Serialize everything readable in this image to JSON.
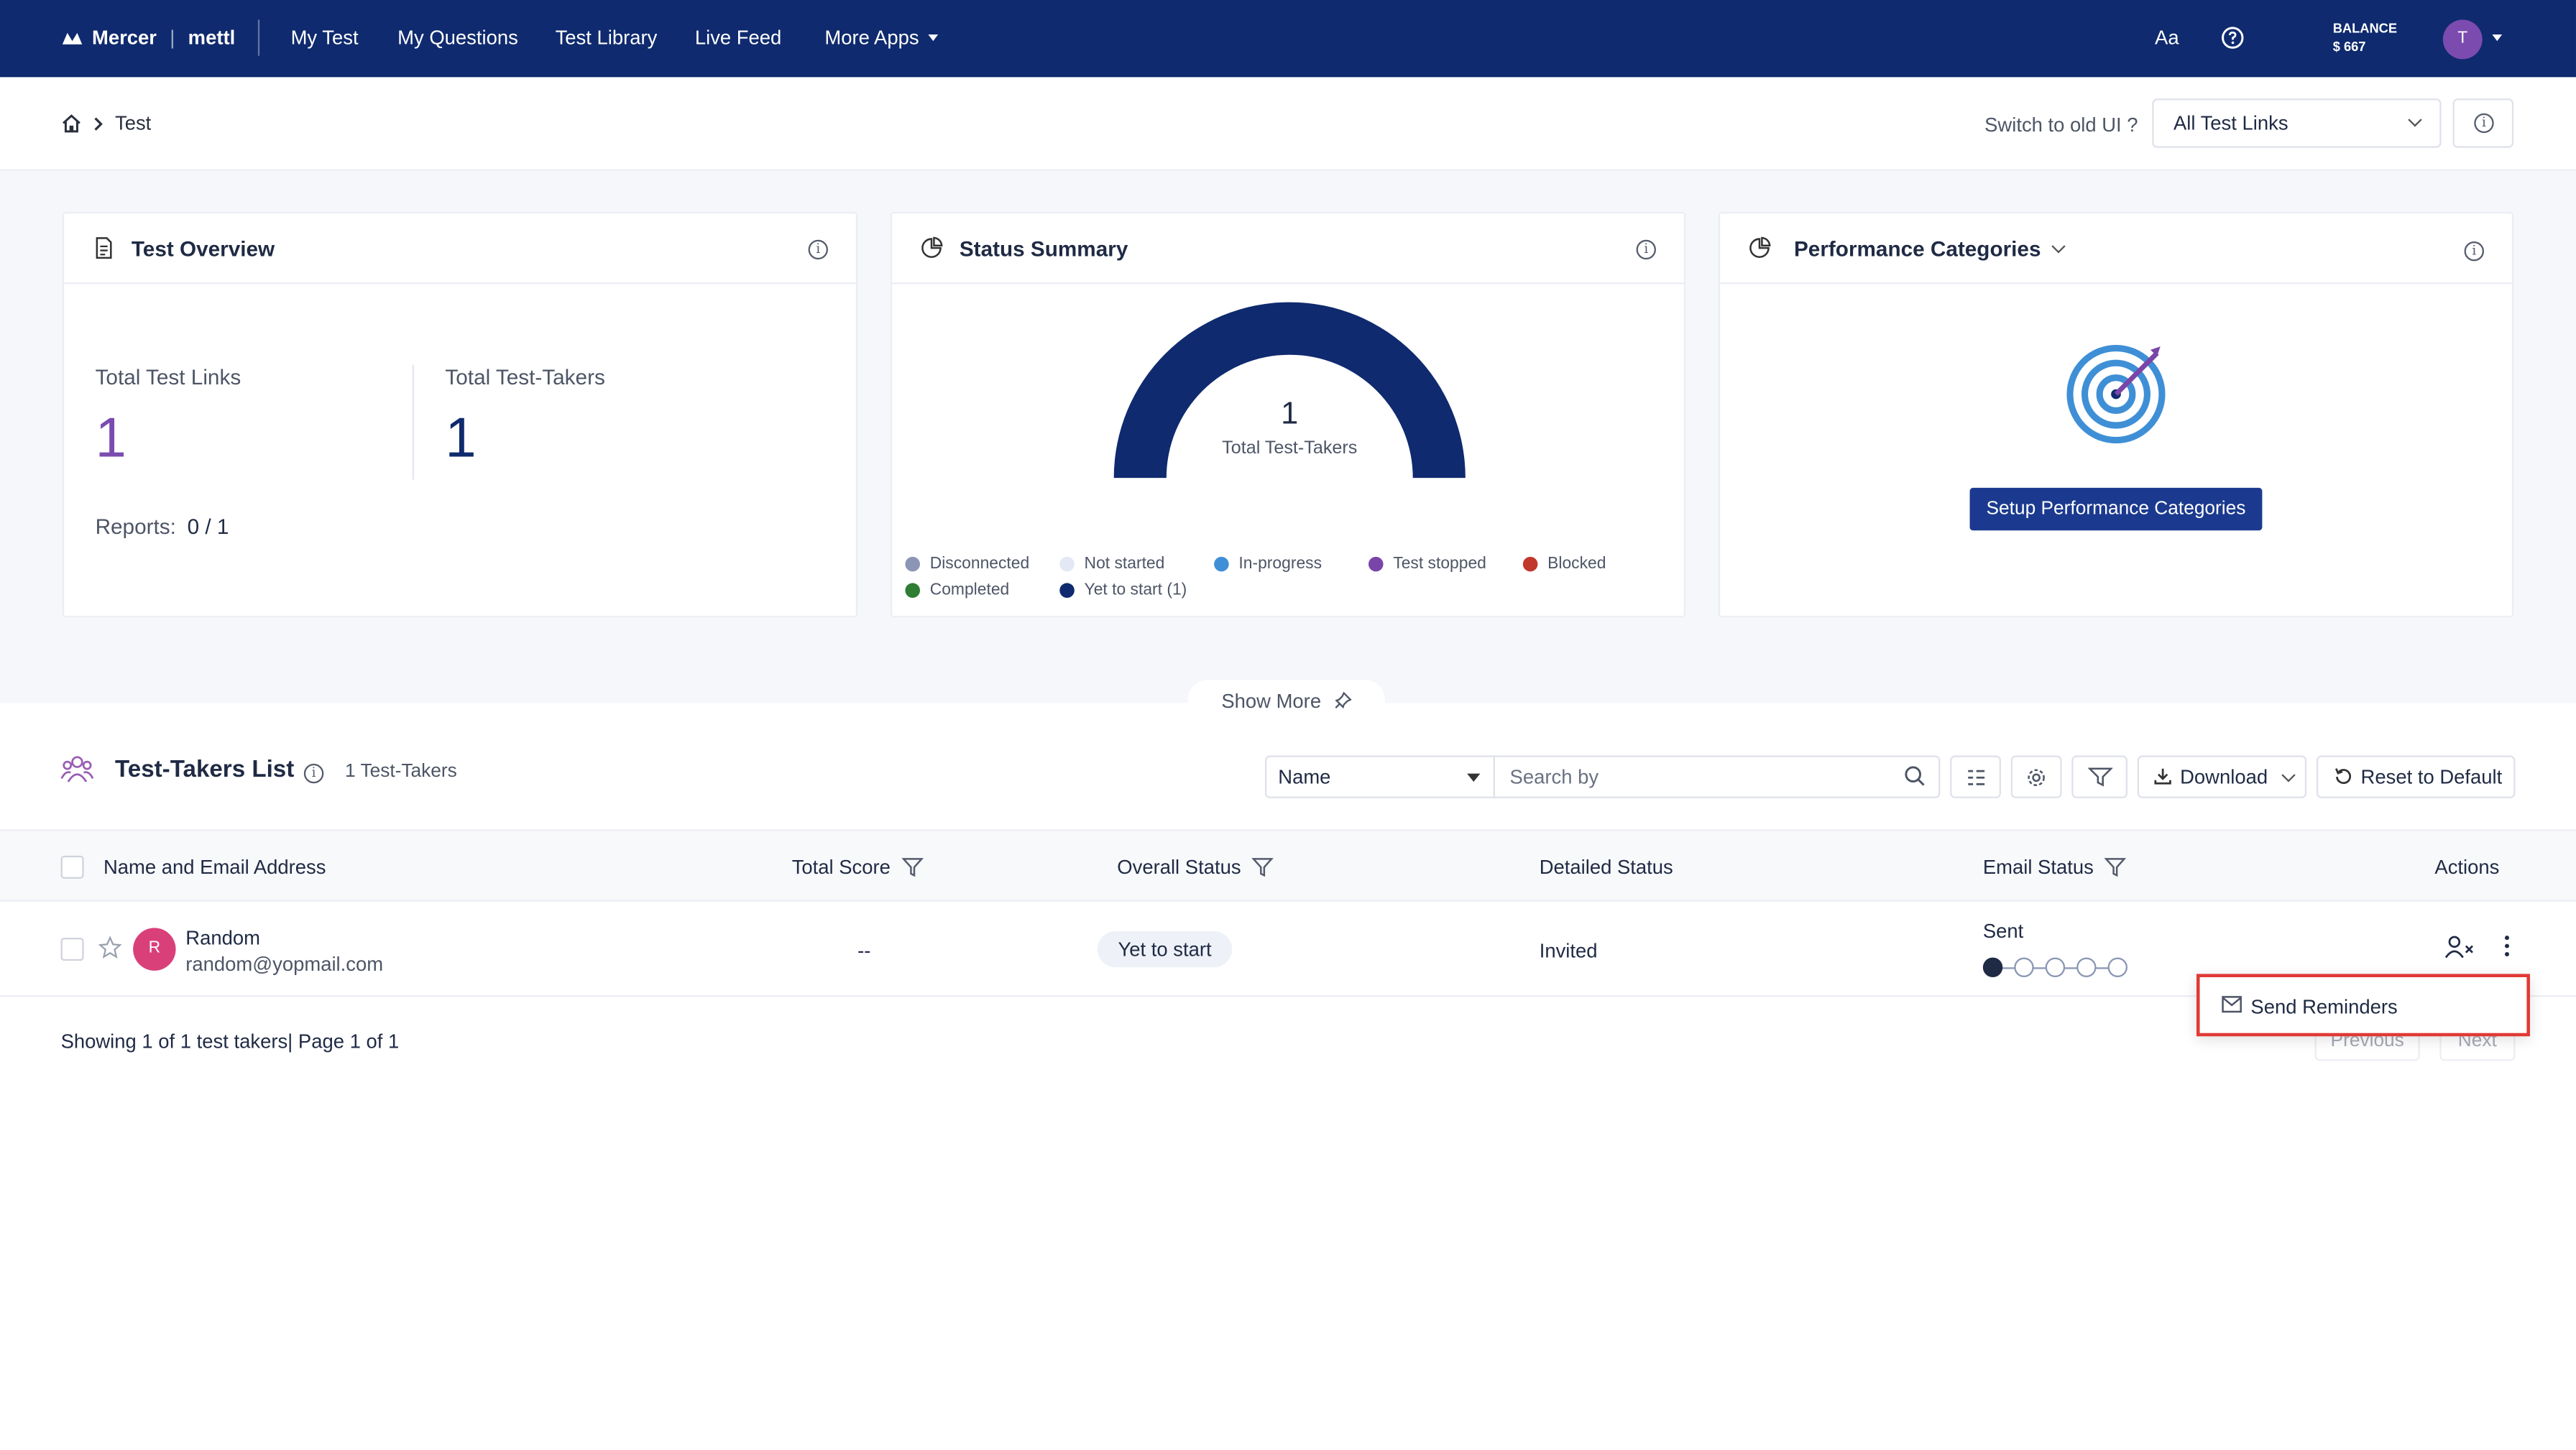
{
  "header": {
    "brand_left": "Mercer",
    "brand_right": "mettl",
    "nav": [
      "My Test",
      "My Questions",
      "Test Library",
      "Live Feed",
      "More Apps"
    ],
    "font_icon": "Aa",
    "balance_label": "BALANCE",
    "balance_value": "$ 667",
    "avatar_initial": "T"
  },
  "subheader": {
    "breadcrumb": "Test",
    "switch_label": "Switch to old UI ?",
    "links_select": "All Test Links"
  },
  "overview": {
    "title": "Test Overview",
    "total_links_label": "Total Test Links",
    "total_links_value": "1",
    "total_takers_label": "Total Test-Takers",
    "total_takers_value": "1",
    "reports_label": "Reports:",
    "reports_value": "0 / 1"
  },
  "status_summary": {
    "title": "Status Summary",
    "center_value": "1",
    "center_label": "Total Test-Takers",
    "legend": [
      {
        "label": "Disconnected",
        "color": "#8b95b5"
      },
      {
        "label": "Not started",
        "color": "#e3e8f4"
      },
      {
        "label": "In-progress",
        "color": "#3f8fd6"
      },
      {
        "label": "Test stopped",
        "color": "#7a45a8"
      },
      {
        "label": "Blocked",
        "color": "#c0392b"
      },
      {
        "label": "Completed",
        "color": "#2e7d32"
      },
      {
        "label": "Yet to start (1)",
        "color": "#0f2a6e"
      }
    ]
  },
  "performance": {
    "title": "Performance Categories",
    "setup_button": "Setup Performance Categories"
  },
  "show_more": "Show More",
  "list": {
    "title": "Test-Takers List",
    "count": "1 Test-Takers",
    "filter_select": "Name",
    "search_placeholder": "Search by",
    "download_label": "Download",
    "reset_label": "Reset to Default",
    "columns": {
      "name": "Name and Email Address",
      "score": "Total Score",
      "overall": "Overall Status",
      "detailed": "Detailed Status",
      "email": "Email Status",
      "actions": "Actions"
    },
    "rows": [
      {
        "initial": "R",
        "name": "Random",
        "email": "random@yopmail.com",
        "score": "--",
        "overall": "Yet to start",
        "detailed": "Invited",
        "email_status": "Sent"
      }
    ]
  },
  "footer": {
    "summary": "Showing 1 of 1 test takers| Page 1 of 1",
    "previous": "Previous",
    "next": "Next"
  },
  "popup": {
    "send_reminders": "Send Reminders"
  }
}
